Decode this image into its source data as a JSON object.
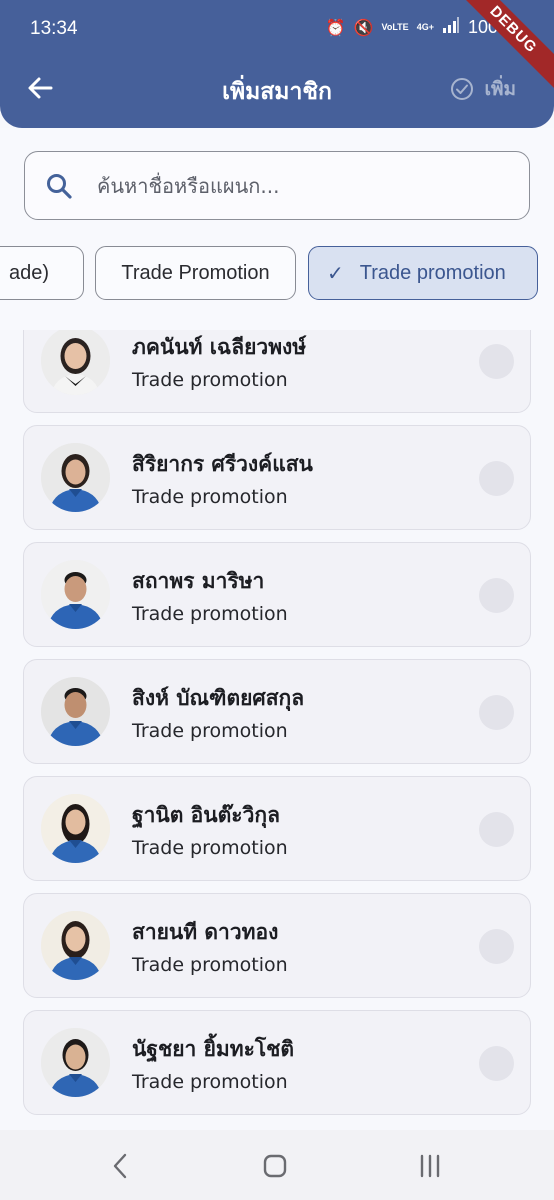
{
  "status_bar": {
    "time": "13:34",
    "volte_label": "VoLTE",
    "network": "4G+",
    "battery": "100%",
    "debug_banner": "DEBUG"
  },
  "appbar": {
    "title": "เพิ่มสมาชิก",
    "add_label": "เพิ่ม"
  },
  "search": {
    "placeholder": "ค้นหาชื่อหรือแผนก..."
  },
  "filter_chips": [
    {
      "label": "ade)",
      "selected": false
    },
    {
      "label": "Trade Promotion",
      "selected": false
    },
    {
      "label": "Trade promotion",
      "selected": true
    }
  ],
  "members": [
    {
      "name": "ภคนันท์ เฉลียวพงษ์",
      "department": "Trade promotion",
      "selected": false
    },
    {
      "name": "สิริยากร ศรีวงค์แสน",
      "department": "Trade promotion",
      "selected": false
    },
    {
      "name": "สถาพร มาริษา",
      "department": "Trade promotion",
      "selected": false
    },
    {
      "name": "สิงห์ บัณฑิตยศสกุล",
      "department": "Trade promotion",
      "selected": false
    },
    {
      "name": "ฐานิต อินต๊ะวิกุล",
      "department": "Trade promotion",
      "selected": false
    },
    {
      "name": "สายนที ดาวทอง",
      "department": "Trade promotion",
      "selected": false
    },
    {
      "name": "นัฐชยา ยิ้มทะโชติ",
      "department": "Trade promotion",
      "selected": false
    }
  ],
  "colors": {
    "header": "#46609a",
    "selected_chip_bg": "#d9e1f1",
    "card_bg": "#f2f2f7"
  }
}
